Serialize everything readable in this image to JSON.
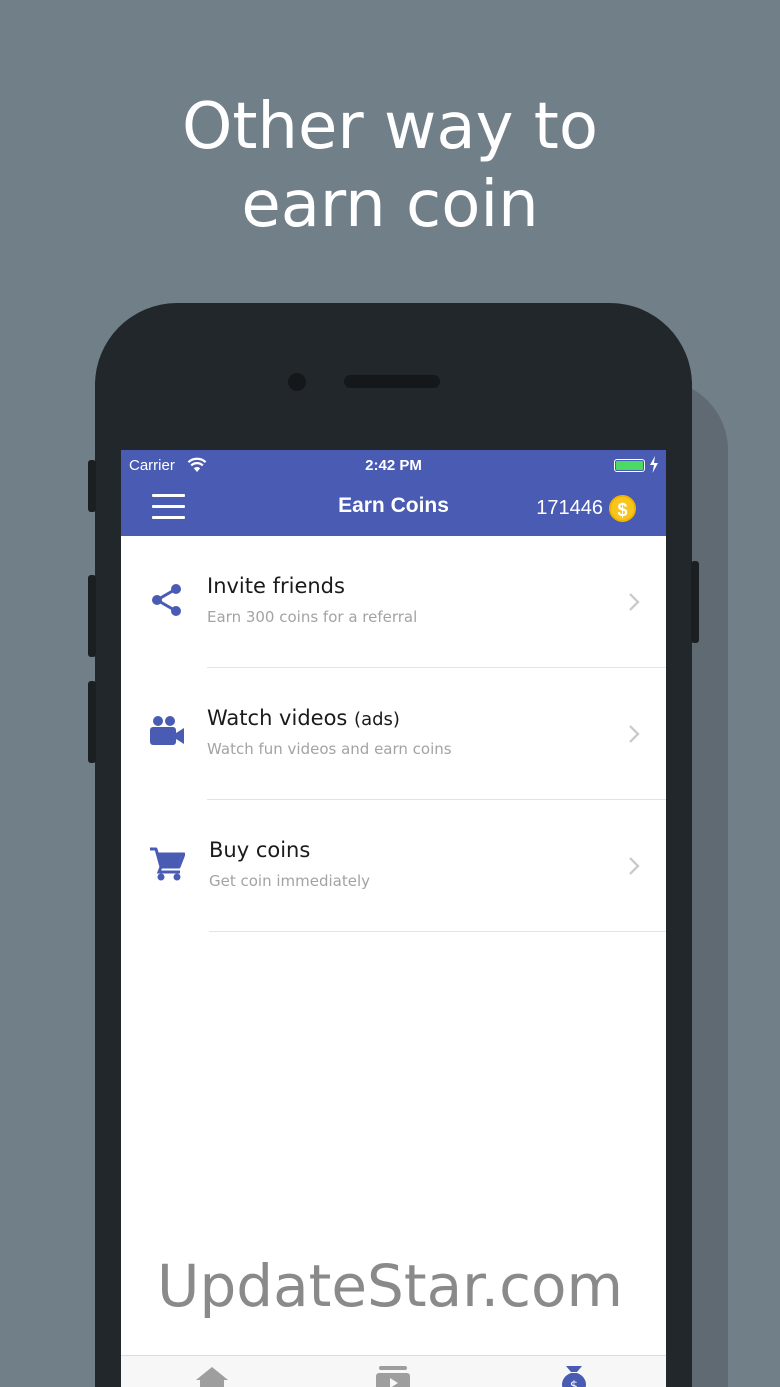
{
  "promo": {
    "headline_line1": "Other way to",
    "headline_line2": "earn coin",
    "watermark": "UpdateStar.com"
  },
  "status_bar": {
    "carrier": "Carrier",
    "time": "2:42 PM",
    "battery_color": "#4cd964"
  },
  "app_bar": {
    "title": "Earn Coins",
    "coin_balance": "171446",
    "coin_symbol": "$",
    "background_color": "#4a5bb4",
    "menu_icon": "hamburger-menu-icon"
  },
  "earn_options": [
    {
      "icon": "share-icon",
      "title": "Invite friends",
      "title_suffix": "",
      "subtitle": "Earn 300 coins for a referral"
    },
    {
      "icon": "video-camera-icon",
      "title": "Watch videos",
      "title_suffix": "(ads)",
      "subtitle": "Watch fun videos and earn coins"
    },
    {
      "icon": "shopping-cart-icon",
      "title": "Buy coins",
      "title_suffix": "",
      "subtitle": "Get coin immediately"
    }
  ],
  "tab_bar": {
    "tabs": [
      {
        "icon": "home-icon"
      },
      {
        "icon": "video-tab-icon"
      },
      {
        "icon": "money-bag-icon",
        "active": true
      }
    ]
  },
  "colors": {
    "page_background": "#717f88",
    "accent": "#4a5bb4",
    "coin": "#f7c51b"
  }
}
